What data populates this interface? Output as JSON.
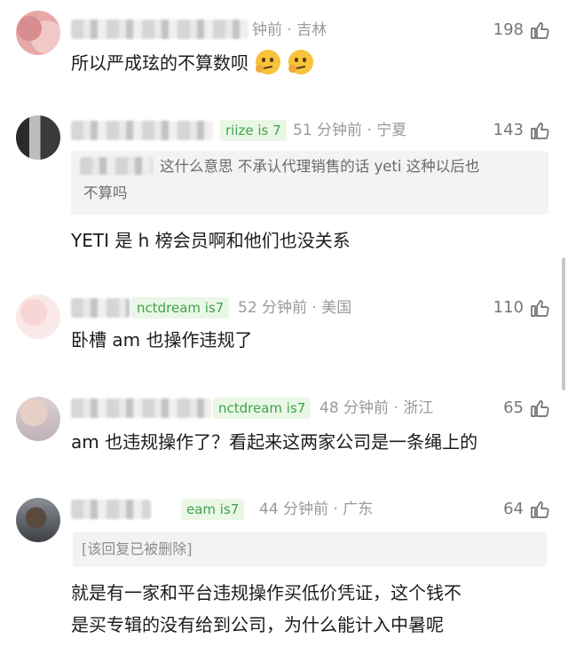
{
  "comments": [
    {
      "meta": "钟前 · 吉林",
      "likes": "198",
      "text": "所以严成玹的不算数呗"
    },
    {
      "badge": "riize is 7",
      "meta": "51 分钟前 · 宁夏",
      "likes": "143",
      "quote_line1": "这什么意思 不承认代理销售的话 yeti 这种以后也",
      "quote_line2": "不算吗",
      "text": "YETI 是 h 榜会员啊和他们也没关系"
    },
    {
      "badge": "nctdream is7",
      "meta": "52 分钟前 · 美国",
      "likes": "110",
      "text": "卧槽 am 也操作违规了"
    },
    {
      "badge": "nctdream is7",
      "meta": "48 分钟前 · 浙江",
      "likes": "65",
      "text": "am 也违规操作了？看起来这两家公司是一条绳上的"
    },
    {
      "badge": "eam is7",
      "meta": "44 分钟前 · 广东",
      "likes": "64",
      "reply_deleted": "[该回复已被删除]",
      "text_line1": "就是有一家和平台违规操作买低价凭证，这个钱不",
      "text_line2": "是买专辑的没有给到公司，为什么能计入中暑呢"
    }
  ],
  "icons": {
    "like": "thumbs-up-icon",
    "emoji": "thinking-face-icon"
  },
  "colors": {
    "badge_text": "#3fa34d",
    "badge_bg": "#eaf7e6",
    "meta": "#9a9a9a"
  }
}
